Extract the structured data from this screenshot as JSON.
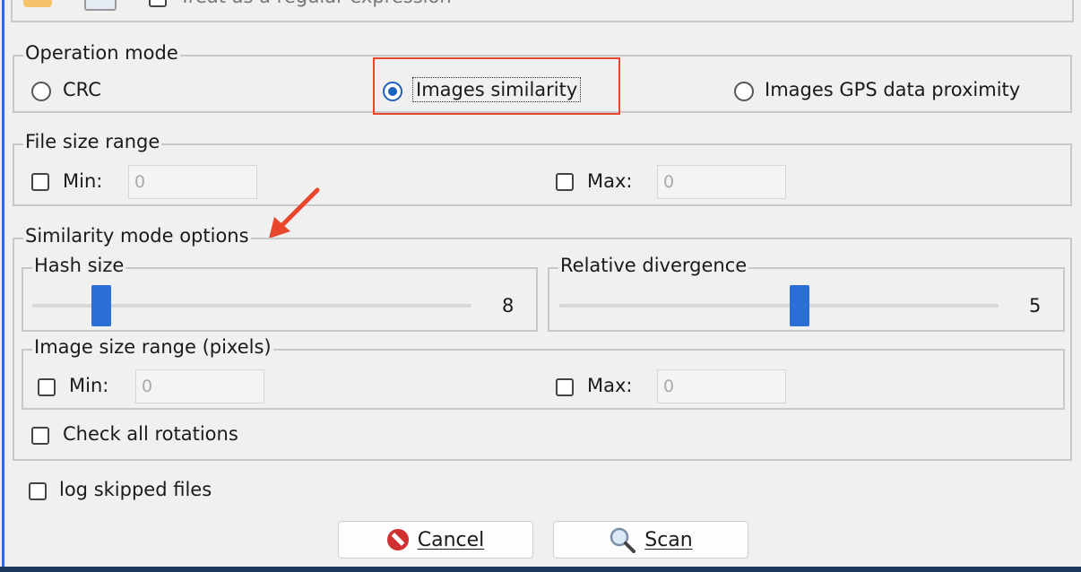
{
  "top": {
    "regex_label": "Treat as a regular expression"
  },
  "operation_mode": {
    "title": "Operation mode",
    "options": [
      {
        "label": "CRC",
        "selected": false
      },
      {
        "label": "Images similarity",
        "selected": true
      },
      {
        "label": "Images GPS data proximity",
        "selected": false
      }
    ]
  },
  "file_size_range": {
    "title": "File size range",
    "min_label": "Min:",
    "min_value": "0",
    "max_label": "Max:",
    "max_value": "0"
  },
  "similarity": {
    "title": "Similarity mode options",
    "hash_size": {
      "title": "Hash size",
      "value": "8"
    },
    "relative_divergence": {
      "title": "Relative divergence",
      "value": "5"
    },
    "image_size_range": {
      "title": "Image size range (pixels)",
      "min_label": "Min:",
      "min_value": "0",
      "max_label": "Max:",
      "max_value": "0"
    },
    "check_rotations": "Check all rotations"
  },
  "log_skipped": "log skipped files",
  "buttons": {
    "cancel": "Cancel",
    "scan": "Scan"
  },
  "colors": {
    "accent": "#1e5fbf",
    "annotation": "#e8472b"
  }
}
